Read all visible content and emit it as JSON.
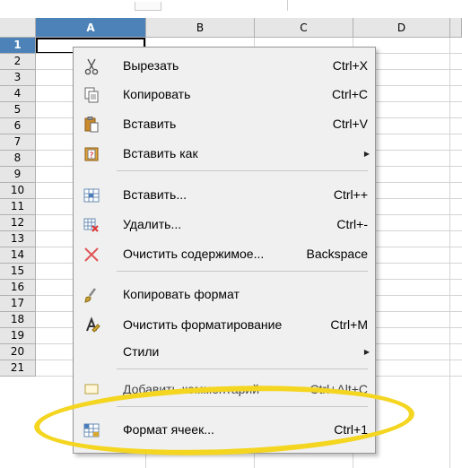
{
  "columns": [
    "A",
    "B",
    "C",
    "D"
  ],
  "selected_column": "A",
  "rows": [
    "1",
    "2",
    "3",
    "4",
    "5",
    "6",
    "7",
    "8",
    "9",
    "10",
    "11",
    "12",
    "13",
    "14",
    "15",
    "16",
    "17",
    "18",
    "19",
    "20",
    "21"
  ],
  "selected_row": "1",
  "context_menu": {
    "items": [
      {
        "label": "Вырезать",
        "shortcut": "Ctrl+X",
        "icon": "scissors-icon"
      },
      {
        "label": "Копировать",
        "shortcut": "Ctrl+C",
        "icon": "copy-icon"
      },
      {
        "label": "Вставить",
        "shortcut": "Ctrl+V",
        "icon": "paste-icon"
      },
      {
        "label": "Вставить как",
        "icon": "paste-special-icon",
        "submenu": true
      },
      {
        "label": "Вставить...",
        "shortcut": "Ctrl++",
        "icon": "insert-cells-icon"
      },
      {
        "label": "Удалить...",
        "shortcut": "Ctrl+-",
        "icon": "delete-cells-icon"
      },
      {
        "label": "Очистить содержимое...",
        "shortcut": "Backspace",
        "icon": "clear-contents-icon"
      },
      {
        "label": "Копировать формат",
        "icon": "format-paintbrush-icon"
      },
      {
        "label": "Очистить форматирование",
        "shortcut": "Ctrl+M",
        "icon": "clear-formatting-icon"
      },
      {
        "label": "Стили",
        "submenu": true
      },
      {
        "label": "Добавить комментарий",
        "shortcut": "Ctrl+Alt+C",
        "icon": "comment-icon"
      },
      {
        "label": "Формат ячеек...",
        "shortcut": "Ctrl+1",
        "icon": "format-cells-icon"
      }
    ]
  },
  "highlight_color": "#f4d51f",
  "selection_color": "#4d82b8"
}
